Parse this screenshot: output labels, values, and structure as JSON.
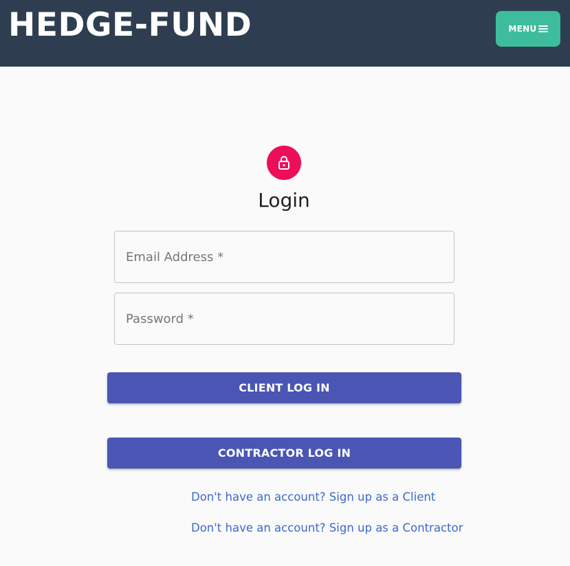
{
  "header": {
    "brand": "HEDGE-FUND",
    "menu_label": "MENU",
    "menu_icon": "hamburger-icon",
    "background_color": "#2e3e50",
    "menu_color": "#3dbd9c"
  },
  "login": {
    "icon": "lock-icon",
    "icon_color": "#ec0e5a",
    "title": "Login",
    "email_placeholder": "Email Address *",
    "email_value": "",
    "password_placeholder": "Password *",
    "password_value": "",
    "client_button": "CLIENT LOG IN",
    "contractor_button": "CONTRACTOR LOG IN",
    "button_color": "#4a55b4",
    "signup_client_link": "Don't have an account? Sign up as a Client",
    "signup_contractor_link": "Don't have an account? Sign up as a Contractor",
    "link_color": "#3f67d0"
  }
}
